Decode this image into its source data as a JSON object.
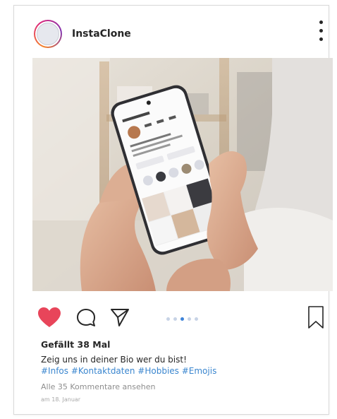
{
  "header": {
    "username": "InstaClone"
  },
  "post": {
    "likes_text": "Gefällt 38 Mal",
    "caption": "Zeig uns in deiner Bio wer du bist!",
    "hashtags": "#Infos #Kontaktdaten #Hobbies #Emojis",
    "comments_link": "Alle 35 Kommentare ansehen",
    "date": "am 18. Januar"
  },
  "carousel": {
    "total": 5,
    "active_index": 2
  },
  "icons": {
    "like": "heart-icon",
    "comment": "comment-bubble-icon",
    "share": "paper-plane-icon",
    "save": "bookmark-icon",
    "more": "more-vertical-icon"
  },
  "colors": {
    "like_active": "#e8455a",
    "hashtag": "#3a86cf",
    "dot_active": "#3d83d8",
    "dot_inactive": "#c7d3e6"
  }
}
